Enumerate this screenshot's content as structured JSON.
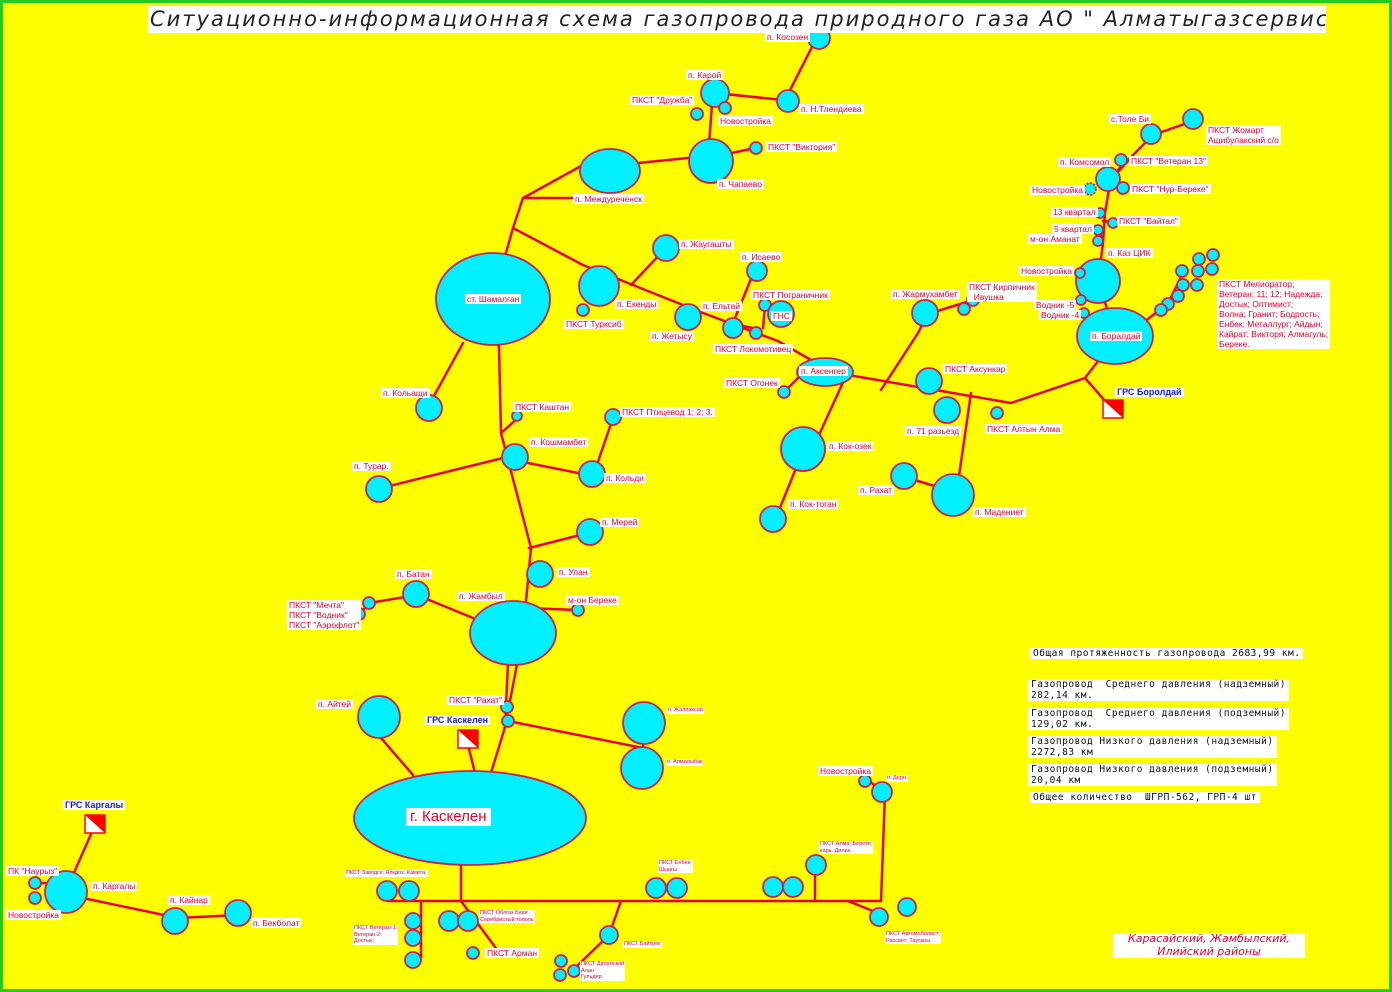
{
  "title": "Ситуационно-информационная схема газопровода природного газа  АО \" Алматыгазсервис -Холдинг\"",
  "labels": {
    "kosozen": "п. Косозен",
    "karoy": "п. Карой",
    "druzhba": "ПКСТ \"Дружба\"",
    "tlendieva": "п. Н.Тлендиева",
    "novostroyka1": "Новостройка",
    "viktoriya": "ПКСТ \"Виктория\"",
    "chapaevo": "п. Чапаево",
    "mezhdurechensk": "п. Междуреченск",
    "shamalgan": "ст. Шамалган",
    "zhaugashty": "п. Жаугашты",
    "isaevo": "п. Исаево",
    "pogranichnik": "ПКСТ Пограничник",
    "gns": "ГНС",
    "ekendy": "п. Екенды",
    "eltay": "п. Ельтай",
    "turksib": "ПКСТ Турксиб",
    "zhetysu": "п. Жетысу",
    "lokomotivets": "ПКСТ Локомотивец",
    "aksengir": "п. Аксенгер",
    "ogonek": "ПКСТ Огонек",
    "zharmukhambet": "п. Жармухамбет",
    "kirpichnik": "ПКСТ Кирпичник\n  Ивушка",
    "toli_bi": "с.Толе Би",
    "zhomart": "ПКСТ Жомарт\nАщибулакский с/о",
    "komsomol": "п. Комсомол",
    "veteran13": "ПКСТ \"Ветеран 13\"",
    "nur_bereke": "ПКСТ \"Нур-Береке\"",
    "novostroyka2": "Новостройка",
    "kvartal13": "13 квартал",
    "baital": "ПКСТ \"Байтал\"",
    "kvartal5": "5 квартал",
    "aimanat": "м-он Аманат",
    "kazcik": "п. Каз ЦИК",
    "novostroyka3": "Новостройка",
    "vodnik5": "Водник -5",
    "vodnik4": "Водник -4",
    "boraldai": "п. Боралдай",
    "meliorator": "ПКСТ Мелиоратор;\nВетеран; 11; 12; Надежда;\nДостык; Оптимист;\nВолна; Гранит; Бодрость;\nЕнбек; Металлург; Айдын;\nКайрат; Викторя; Алмагуль;\nБереке.",
    "grs_boraldai": "ГРС Боролдай",
    "aksunkar": "ПКСТ Аксункар",
    "razezd71": "п. 71 разьезд",
    "altyn_alma": "ПКСТ Алтын Алма",
    "koltsashi": "п. Кольащи",
    "kashtan": "ПКСТ Каштан",
    "ptitsevod": "ПКСТ Птицевод 1; 2; 3.",
    "koshmambet": "п. Кошмамбет",
    "turar": "п. Турар.",
    "koldi": "п. Кольди",
    "kok_ozek": "п. Кок-озек",
    "kok_togan": "п. Кок-тоган",
    "rakhat": "п. Рахат",
    "madeniet": "п. Мадениет",
    "merey": "п. Мерей",
    "ulan": "п. Улан",
    "bereke": "м-он Береке",
    "batan": "п. Батан",
    "zhambyl": "п. Жамбыл",
    "mechta": "ПКСТ \"Мечта\"\nПКСТ \"Водник\"\nПКСТ \"Аэрофлот\"",
    "aitey": "п. Айтей",
    "rakhat_pkst": "ПКСТ \"Рахат\"",
    "grs_kaskelen": "ГРС Каскелен",
    "zhalpaksay": "п. Жалпаксай",
    "almalybak": "п. Алмалыбак",
    "kaskelen": "г. Каскелен",
    "grs_kargaly": "ГРС Каргалы",
    "nauryz": "ПК \"Наурыз\"",
    "kargaly": "п. Каргалы",
    "novostroyka4": "Новостройка",
    "kainar": "п. Кайнар",
    "bekbolat": "п. Бекболат",
    "zavodskoy": "ПКСТ Заводск; Ялкдоз; Камета.",
    "veteran1": "ПКСТ Ветеран-1;\nВетеран-2;\nДостык;",
    "oblgaz": "ПКСТ Облгаз Бахи\nСеребристый тополь",
    "arman": "ПКСТ Арман",
    "enbek_shyngy": "ПКСТ Енбек;\nШынгы",
    "baiterek": "ПКСТ Байтрек",
    "dalansay": "ПКСТ Даланский\nАлан\nГульдер",
    "alma_bereke": "ПКСТ Алма; Береке;\nкарь. Дилин.",
    "avtomobilist": "ПКСТ Автомобилист;\nРассвет; Тауганы.",
    "novostroyka5": "Новостройка",
    "derm": "п. Дерн."
  },
  "info": {
    "total": "Общая протяженность газопровода 2683,99 км.",
    "mid_above": "Газопровод  Среднего давления (надземный)\n282,14 км.",
    "mid_under": "Газопровод  Среднего давления (подземный)\n129,02 км.",
    "low_above": "Газопровод Низкого давления (надземный)\n2272,83 км",
    "low_under": "Газопровод Низкого давления (подземный)\n20,04 км",
    "counts": "Общее количество  ШГРП-562, ГРП-4 шт"
  },
  "regions": "Карасайский, Жамбылский,\nИлийский районы",
  "colors": {
    "background": "#ffff00",
    "frame": "#22cc22",
    "pipeline": "#e8002a",
    "node_fill": "#00f0ff",
    "node_stroke": "#cc1f4a",
    "text_red": "#e8002a",
    "text_blue": "#1a1ae6",
    "grs_red": "#ff0000"
  }
}
